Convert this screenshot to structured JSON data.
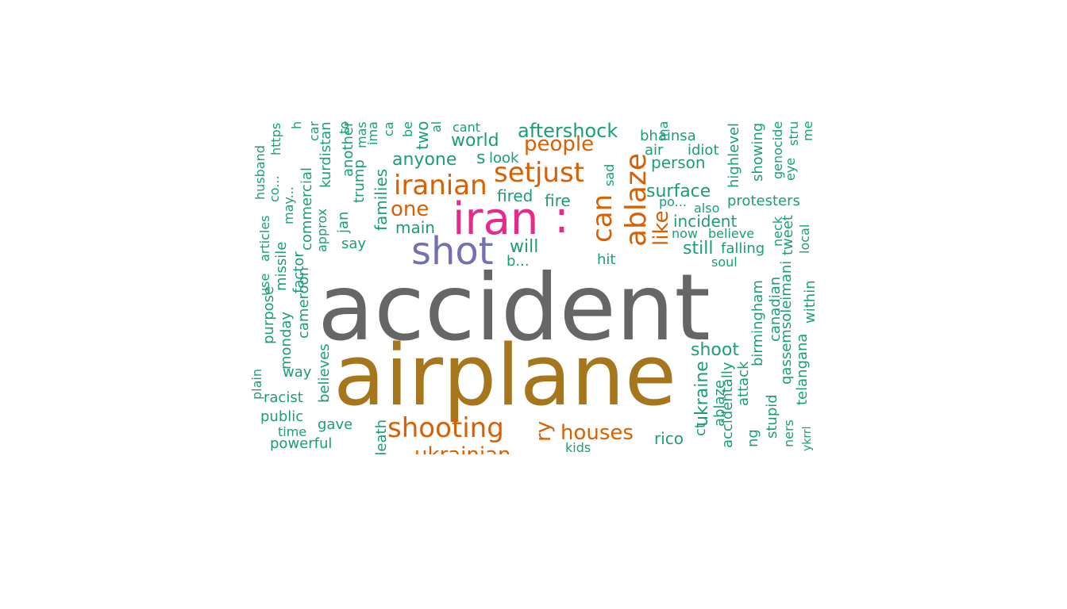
{
  "chart_data": {
    "type": "wordcloud",
    "title": "",
    "colors": {
      "grey": "#666666",
      "olive": "#A6761D",
      "pink": "#E7298A",
      "purple": "#7570B3",
      "orange": "#D95F02",
      "green": "#1B9E77"
    },
    "words": [
      {
        "text": "accident",
        "color": "grey",
        "weight": 100
      },
      {
        "text": "airplane",
        "color": "olive",
        "weight": 90
      },
      {
        "text": "iran",
        "color": "pink",
        "weight": 50
      },
      {
        "text": ":",
        "color": "pink",
        "weight": 50
      },
      {
        "text": "shot",
        "color": "purple",
        "weight": 40
      },
      {
        "text": "ablaze",
        "color": "orange",
        "weight": 32
      },
      {
        "text": "can",
        "color": "orange",
        "weight": 32
      },
      {
        "text": "setjust",
        "color": "orange",
        "weight": 30
      },
      {
        "text": "iranian",
        "color": "orange",
        "weight": 30
      },
      {
        "text": "shooting",
        "color": "orange",
        "weight": 30
      },
      {
        "text": "houses",
        "color": "orange",
        "weight": 24
      },
      {
        "text": "people",
        "color": "orange",
        "weight": 24
      },
      {
        "text": "one",
        "color": "orange",
        "weight": 24
      },
      {
        "text": "like",
        "color": "orange",
        "weight": 24
      },
      {
        "text": "ukrainian",
        "color": "orange",
        "weight": 24
      },
      {
        "text": "ry",
        "color": "orange",
        "weight": 24
      },
      {
        "text": "aftershock",
        "color": "green",
        "weight": 20
      },
      {
        "text": "world",
        "color": "green",
        "weight": 20
      },
      {
        "text": "anyone",
        "color": "green",
        "weight": 18
      },
      {
        "text": "s",
        "color": "green",
        "weight": 18
      },
      {
        "text": "look",
        "color": "green",
        "weight": 14
      },
      {
        "text": "surface",
        "color": "green",
        "weight": 18
      },
      {
        "text": "person",
        "color": "green",
        "weight": 16
      },
      {
        "text": "bhainsa",
        "color": "green",
        "weight": 14
      },
      {
        "text": "air",
        "color": "green",
        "weight": 14
      },
      {
        "text": "idiot",
        "color": "green",
        "weight": 14
      },
      {
        "text": "fired",
        "color": "green",
        "weight": 16
      },
      {
        "text": "fire",
        "color": "green",
        "weight": 16
      },
      {
        "text": "main",
        "color": "green",
        "weight": 16
      },
      {
        "text": "will",
        "color": "green",
        "weight": 18
      },
      {
        "text": "b...",
        "color": "green",
        "weight": 14
      },
      {
        "text": "hit",
        "color": "green",
        "weight": 14
      },
      {
        "text": "incident",
        "color": "green",
        "weight": 18
      },
      {
        "text": "now",
        "color": "green",
        "weight": 14
      },
      {
        "text": "believe",
        "color": "green",
        "weight": 14
      },
      {
        "text": "still",
        "color": "green",
        "weight": 18
      },
      {
        "text": "falling",
        "color": "green",
        "weight": 16
      },
      {
        "text": "soul",
        "color": "green",
        "weight": 13
      },
      {
        "text": "po...",
        "color": "green",
        "weight": 13
      },
      {
        "text": "also",
        "color": "green",
        "weight": 14
      },
      {
        "text": "protesters",
        "color": "green",
        "weight": 16
      },
      {
        "text": "shoot",
        "color": "green",
        "weight": 18
      },
      {
        "text": "rico",
        "color": "green",
        "weight": 18
      },
      {
        "text": "gave",
        "color": "green",
        "weight": 16
      },
      {
        "text": "racist",
        "color": "green",
        "weight": 16
      },
      {
        "text": "public",
        "color": "green",
        "weight": 16
      },
      {
        "text": "time",
        "color": "green",
        "weight": 14
      },
      {
        "text": "powerful",
        "color": "green",
        "weight": 16
      },
      {
        "text": "way",
        "color": "green",
        "weight": 16
      },
      {
        "text": "say",
        "color": "green",
        "weight": 16
      },
      {
        "text": "kids",
        "color": "green",
        "weight": 13
      },
      {
        "text": "cant",
        "color": "green",
        "weight": 13
      },
      {
        "text": "families",
        "color": "green",
        "weight": 18
      },
      {
        "text": "trump",
        "color": "green",
        "weight": 18
      },
      {
        "text": "another",
        "color": "green",
        "weight": 16
      },
      {
        "text": "jan",
        "color": "green",
        "weight": 16
      },
      {
        "text": "kurdistan",
        "color": "green",
        "weight": 16
      },
      {
        "text": "approx",
        "color": "green",
        "weight": 14
      },
      {
        "text": "commercial",
        "color": "green",
        "weight": 16
      },
      {
        "text": "cameroon",
        "color": "green",
        "weight": 16
      },
      {
        "text": "factor",
        "color": "green",
        "weight": 16
      },
      {
        "text": "missile",
        "color": "green",
        "weight": 16
      },
      {
        "text": "monday",
        "color": "green",
        "weight": 16
      },
      {
        "text": "purpose",
        "color": "green",
        "weight": 16
      },
      {
        "text": "use",
        "color": "green",
        "weight": 14
      },
      {
        "text": "articles",
        "color": "green",
        "weight": 14
      },
      {
        "text": "husband",
        "color": "green",
        "weight": 14
      },
      {
        "text": "https",
        "color": "green",
        "weight": 14
      },
      {
        "text": "co...",
        "color": "green",
        "weight": 14
      },
      {
        "text": "may...",
        "color": "green",
        "weight": 14
      },
      {
        "text": "believes",
        "color": "green",
        "weight": 16
      },
      {
        "text": "plain",
        "color": "green",
        "weight": 14
      },
      {
        "text": "ukraine",
        "color": "green",
        "weight": 18
      },
      {
        "text": "ablaze",
        "color": "green",
        "weight": 16
      },
      {
        "text": "accidentally",
        "color": "green",
        "weight": 16
      },
      {
        "text": "attack",
        "color": "green",
        "weight": 16
      },
      {
        "text": "birmingham",
        "color": "green",
        "weight": 16
      },
      {
        "text": "canadian",
        "color": "green",
        "weight": 16
      },
      {
        "text": "qassemsoleimani",
        "color": "green",
        "weight": 16
      },
      {
        "text": "telangana",
        "color": "green",
        "weight": 16
      },
      {
        "text": "within",
        "color": "green",
        "weight": 16
      },
      {
        "text": "stupid",
        "color": "green",
        "weight": 16
      },
      {
        "text": "neck",
        "color": "green",
        "weight": 14
      },
      {
        "text": "tweet",
        "color": "green",
        "weight": 16
      },
      {
        "text": "local",
        "color": "green",
        "weight": 14
      },
      {
        "text": "highlevel",
        "color": "green",
        "weight": 16
      },
      {
        "text": "showing",
        "color": "green",
        "weight": 16
      },
      {
        "text": "genocide",
        "color": "green",
        "weight": 14
      },
      {
        "text": "eye",
        "color": "green",
        "weight": 14
      },
      {
        "text": "sad",
        "color": "green",
        "weight": 14
      },
      {
        "text": "ma",
        "color": "green",
        "weight": 14
      },
      {
        "text": "two",
        "color": "green",
        "weight": 18
      },
      {
        "text": "ima",
        "color": "green",
        "weight": 14
      },
      {
        "text": "ca",
        "color": "green",
        "weight": 14
      },
      {
        "text": "mas",
        "color": "green",
        "weight": 14
      },
      {
        "text": "death",
        "color": "green",
        "weight": 16
      },
      {
        "text": "ng",
        "color": "green",
        "weight": 16
      },
      {
        "text": "ners",
        "color": "green",
        "weight": 14
      },
      {
        "text": "ykrrl",
        "color": "green",
        "weight": 14
      },
      {
        "text": "stru",
        "color": "green",
        "weight": 14
      },
      {
        "text": "me",
        "color": "green",
        "weight": 14
      },
      {
        "text": "car",
        "color": "green",
        "weight": 14
      },
      {
        "text": "to",
        "color": "green",
        "weight": 14
      },
      {
        "text": "h",
        "color": "green",
        "weight": 14
      },
      {
        "text": "be",
        "color": "green",
        "weight": 14
      },
      {
        "text": "al",
        "color": "green",
        "weight": 14
      },
      {
        "text": "ct",
        "color": "green",
        "weight": 16
      }
    ]
  }
}
